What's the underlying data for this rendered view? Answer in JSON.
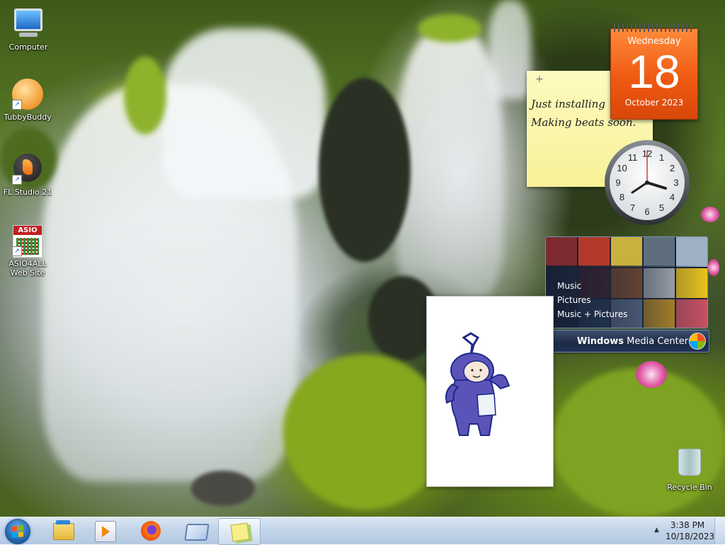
{
  "desktop_icons": [
    {
      "label": "Computer"
    },
    {
      "label": "TubbyBuddy"
    },
    {
      "label": "FL Studio 21"
    },
    {
      "label": "ASIO4ALL\nWeb Site",
      "badge": "ASIO"
    },
    {
      "label": "Recycle Bin"
    }
  ],
  "calendar": {
    "weekday": "Wednesday",
    "day": "18",
    "month_year": "October 2023"
  },
  "sticky_note": {
    "add_symbol": "+",
    "text": "Just installing\nMaking beats soon."
  },
  "clock": {
    "numbers": [
      "12",
      "1",
      "2",
      "3",
      "4",
      "5",
      "6",
      "7",
      "8",
      "9",
      "10",
      "11"
    ]
  },
  "media_center": {
    "items": [
      "Music",
      "Pictures",
      "Music + Pictures"
    ],
    "title_bold": "Windows",
    "title_rest": " Media Center"
  },
  "taskbar": {
    "pinned": [
      "windows-explorer",
      "windows-media-player",
      "firefox",
      "monitor-app",
      "sticky-notes"
    ],
    "time": "3:38 PM",
    "date": "10/18/2023",
    "tray_arrow": "▲"
  },
  "colors": {
    "calendar": "#ef5a12",
    "sticky": "#f7f197",
    "taskbar": "#c2d4e8",
    "teletubby": "#5b54b8"
  }
}
